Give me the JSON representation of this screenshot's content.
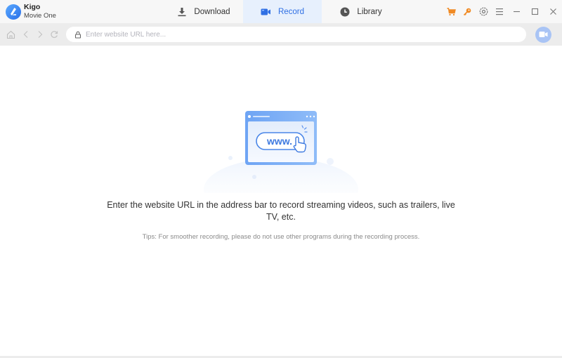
{
  "app": {
    "name": "Kigo",
    "subtitle": "Movie One"
  },
  "tabs": [
    {
      "label": "Download",
      "icon": "download-icon",
      "active": false
    },
    {
      "label": "Record",
      "icon": "video-camera-icon",
      "active": true
    },
    {
      "label": "Library",
      "icon": "clock-icon",
      "active": false
    }
  ],
  "toolbar_icons": [
    "cart-icon",
    "key-icon",
    "settings-icon",
    "menu-icon"
  ],
  "window_controls": [
    "minimize-icon",
    "maximize-icon",
    "close-icon"
  ],
  "address_bar": {
    "url_value": "",
    "url_placeholder": "Enter website URL here..."
  },
  "main": {
    "illustration_text": "www.",
    "headline": "Enter the website URL in the address bar to record streaming videos, such as trailers, live TV, etc.",
    "tips": "Tips: For smoother recording, please do not use other programs during the recording process."
  },
  "colors": {
    "accent": "#2f6fe4",
    "active_tab_bg": "#e7f0fd",
    "toolbar_orange": "#f08a24",
    "record_button": "#a9c4f5"
  }
}
